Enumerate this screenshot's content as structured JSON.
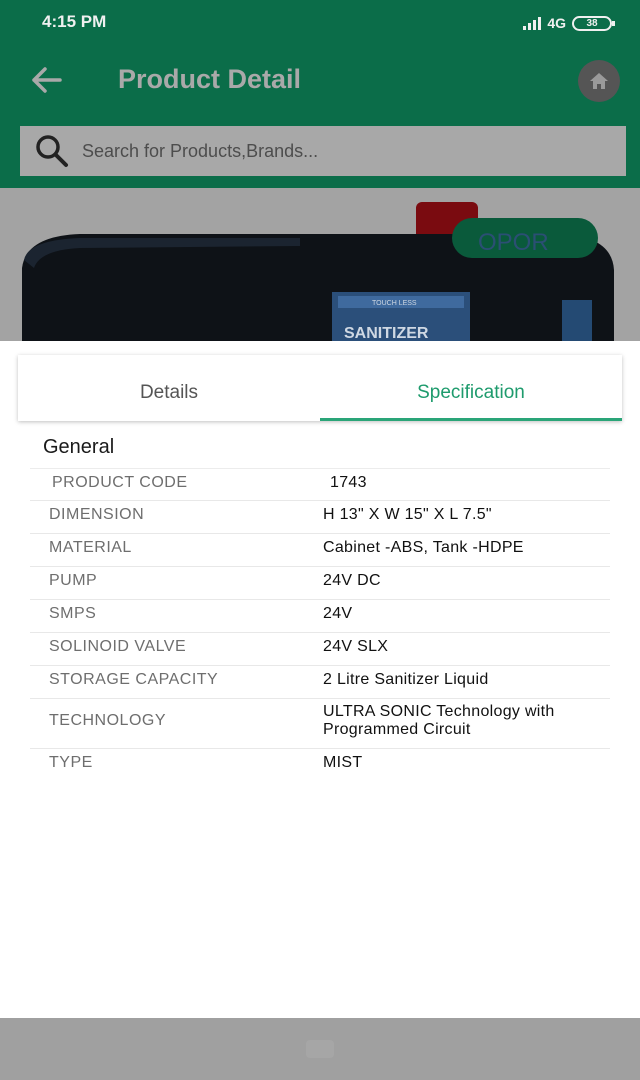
{
  "status_bar": {
    "time": "4:15 PM",
    "network": "4G",
    "battery": "38"
  },
  "app_bar": {
    "title": "Product Detail",
    "back_icon": "back-arrow-icon",
    "home_icon": "home-icon"
  },
  "search": {
    "placeholder": "Search for Products,Brands...",
    "value": "",
    "icon": "search-icon"
  },
  "product_image": {
    "label_badge": "TOUCH LESS",
    "label_text": "SANITIZER",
    "brand_logo": "OPOR"
  },
  "tabs": [
    {
      "label": "Details",
      "selected": false
    },
    {
      "label": "Specification",
      "selected": true
    }
  ],
  "section": {
    "title": "General"
  },
  "specs": [
    {
      "label": "PRODUCT CODE",
      "value": "1743"
    },
    {
      "label": "DIMENSION",
      "value": "H 13\" X W 15\" X L 7.5\""
    },
    {
      "label": "MATERIAL",
      "value": "Cabinet -ABS, Tank -HDPE"
    },
    {
      "label": "PUMP",
      "value": "24V DC"
    },
    {
      "label": "SMPS",
      "value": "24V"
    },
    {
      "label": "SOLINOID VALVE",
      "value": "24V SLX"
    },
    {
      "label": "STORAGE CAPACITY",
      "value": "2 Litre Sanitizer Liquid"
    },
    {
      "label": "TECHNOLOGY",
      "value": "ULTRA SONIC Technology with Programmed Circuit"
    },
    {
      "label": "TYPE",
      "value": "MIST"
    }
  ],
  "colors": {
    "primary": "#0b6d49",
    "accent": "#1e9b6d",
    "overlay": "#a0a0a0"
  }
}
